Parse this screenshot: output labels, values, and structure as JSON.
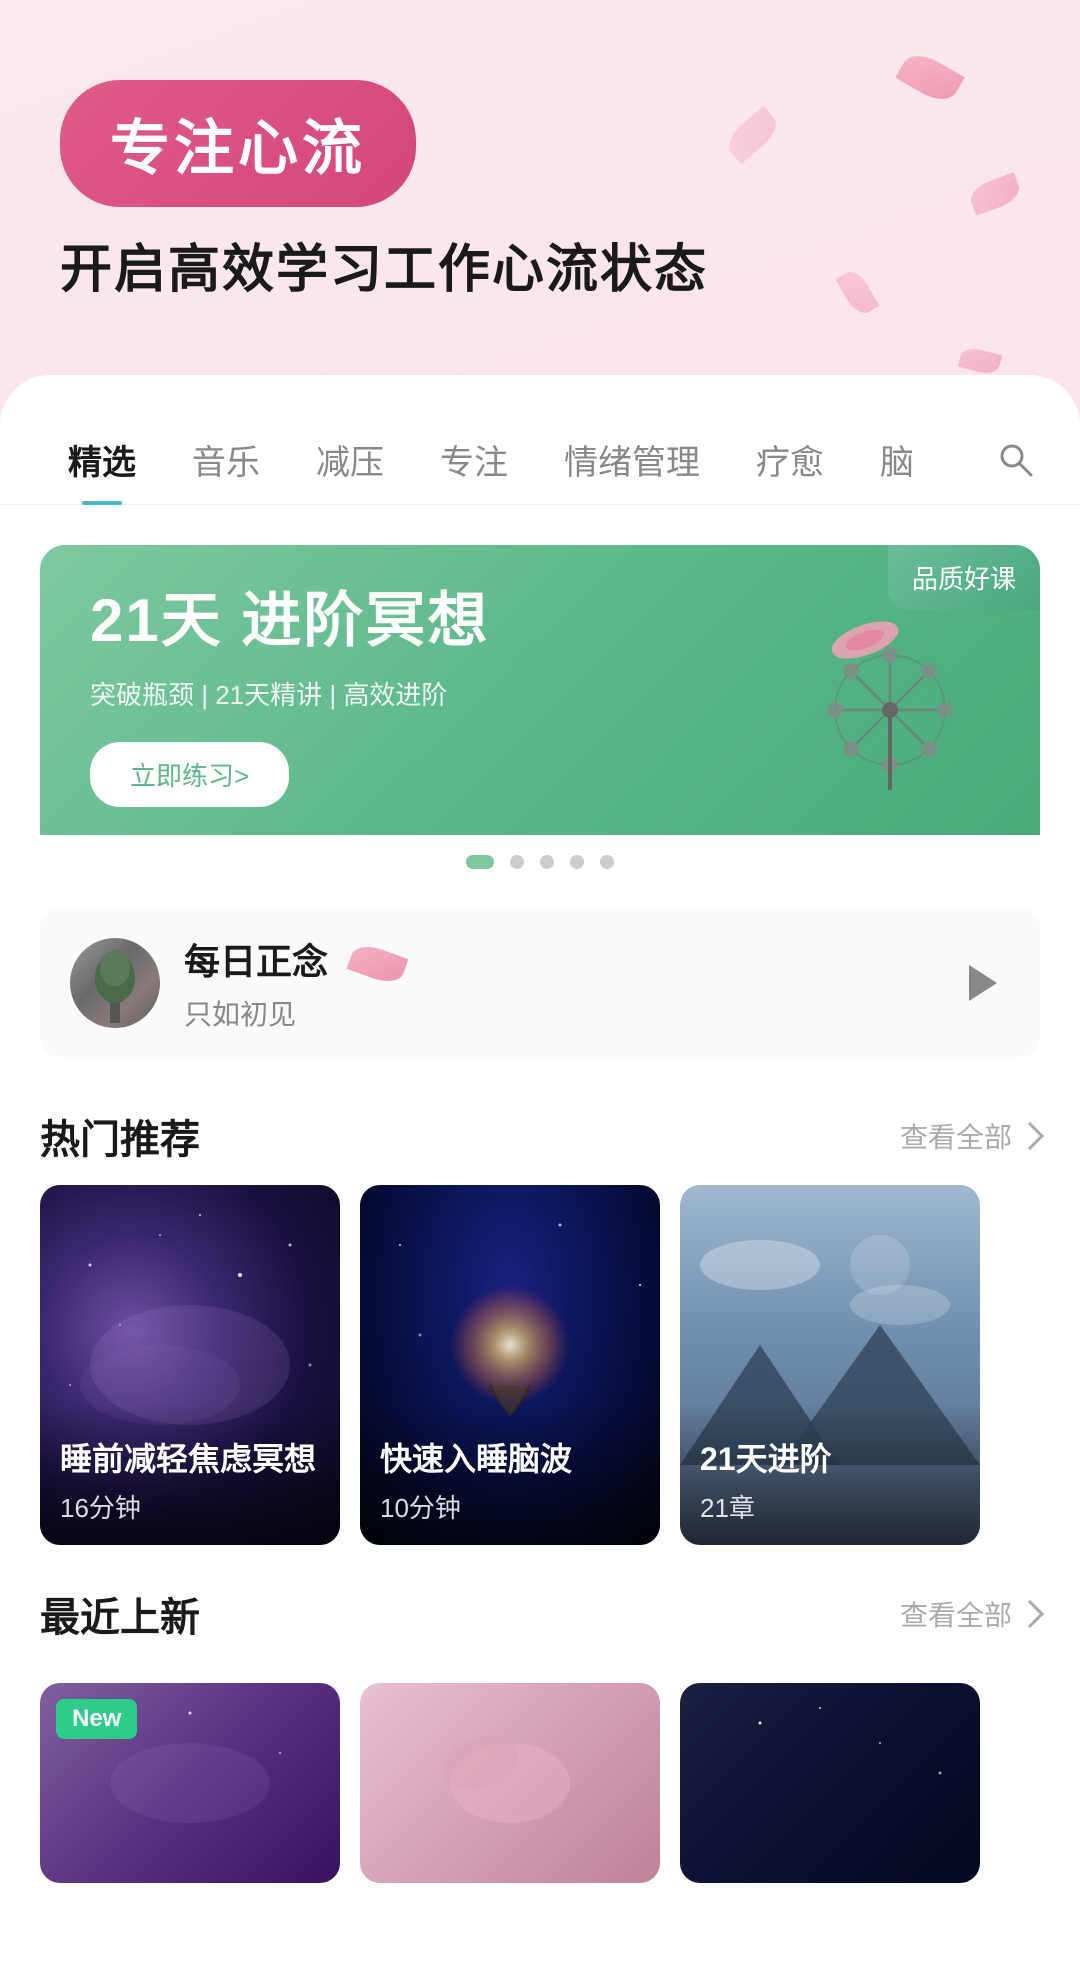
{
  "hero": {
    "badge_text": "专注心流",
    "subtitle": "开启高效学习工作心流状态"
  },
  "tabs": {
    "items": [
      {
        "label": "精选",
        "active": true
      },
      {
        "label": "音乐",
        "active": false
      },
      {
        "label": "减压",
        "active": false
      },
      {
        "label": "专注",
        "active": false
      },
      {
        "label": "情绪管理",
        "active": false
      },
      {
        "label": "疗愈",
        "active": false
      },
      {
        "label": "脑",
        "active": false
      }
    ]
  },
  "banner": {
    "quality_badge": "品质好课",
    "title": "21天 进阶冥想",
    "description": "突破瓶颈 | 21天精讲 | 高效进阶",
    "cta": "立即练习>",
    "dots_count": 5,
    "active_dot": 0
  },
  "daily": {
    "title": "每日正念",
    "subtitle": "只如初见"
  },
  "hot_section": {
    "title": "热门推荐",
    "more_label": "查看全部",
    "items": [
      {
        "title": "睡前减轻焦虑冥想",
        "meta": "16分钟",
        "bg": "galaxy1"
      },
      {
        "title": "快速入睡脑波",
        "meta": "10分钟",
        "bg": "galaxy2"
      },
      {
        "title": "21天进阶",
        "meta": "21章",
        "bg": "sky"
      }
    ]
  },
  "recent_section": {
    "title": "最近上新",
    "more_label": "查看全部",
    "items": [
      {
        "has_new_badge": true,
        "new_label": "New",
        "bg": "purple"
      },
      {
        "has_new_badge": false,
        "bg": "pink_petal"
      },
      {
        "has_new_badge": false,
        "bg": "dark_blue"
      }
    ]
  }
}
